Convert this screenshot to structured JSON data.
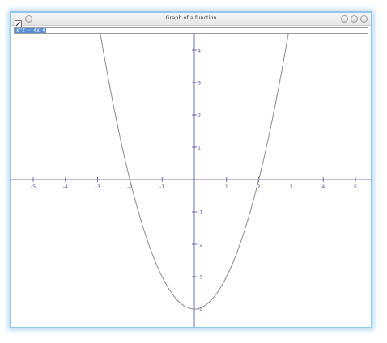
{
  "window": {
    "title": "Graph of a function"
  },
  "expression": {
    "value": "x^2 - 4x 4"
  },
  "icons": {
    "app": "pencil-graph-icon",
    "menu": "window-menu-icon",
    "minimize": "minimize-icon",
    "maximize": "maximize-icon",
    "close": "close-icon"
  },
  "colors": {
    "axis": "#4a4a9a",
    "curve": "#8a8a8a",
    "selection": "#5b8fd6",
    "frame": "#8fc6ea"
  },
  "chart_data": {
    "type": "line",
    "function": "x^2 - 4",
    "xlim": [
      -5.5,
      5.5
    ],
    "ylim": [
      -4.5,
      4.5
    ],
    "x_ticks": [
      -5,
      -4,
      -3,
      -2,
      -1,
      1,
      2,
      3,
      4,
      5
    ],
    "x_tick_labels": [
      "-5",
      "-4",
      "-3",
      "-2",
      "-1",
      "1",
      "2",
      "3",
      "4",
      "5"
    ],
    "y_ticks": [
      -4,
      -3,
      -2,
      -1,
      1,
      2,
      3,
      4
    ],
    "y_tick_labels": [
      "-4",
      "-3",
      "-2",
      "-1",
      "1",
      "2",
      "3",
      "4"
    ],
    "series": [
      {
        "x": [
          -3.0,
          -2.5,
          -2.0,
          -1.5,
          -1.0,
          -0.5,
          0.0,
          0.5,
          1.0,
          1.5,
          2.0,
          2.5,
          3.0
        ],
        "y": [
          5.0,
          2.25,
          0.0,
          -1.75,
          -3.0,
          -3.75,
          -4.0,
          -3.75,
          -3.0,
          -1.75,
          0.0,
          2.25,
          5.0
        ]
      }
    ],
    "grid": false
  }
}
